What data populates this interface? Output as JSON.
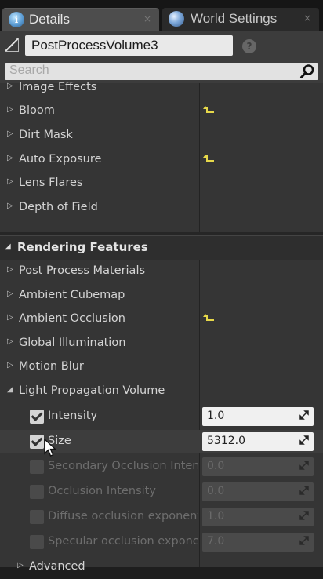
{
  "tabs": [
    {
      "label": "Details",
      "icon": "info-icon",
      "close": "×"
    },
    {
      "label": "World Settings",
      "icon": "globe-icon",
      "close": "×"
    }
  ],
  "object": {
    "name": "PostProcessVolume3",
    "help": "?"
  },
  "search": {
    "placeholder": "Search"
  },
  "sections_top": [
    {
      "label": "Image Effects",
      "arrow": "▷",
      "reset": false
    },
    {
      "label": "Bloom",
      "arrow": "▷",
      "reset": true
    },
    {
      "label": "Dirt Mask",
      "arrow": "▷",
      "reset": false
    },
    {
      "label": "Auto Exposure",
      "arrow": "▷",
      "reset": true
    },
    {
      "label": "Lens Flares",
      "arrow": "▷",
      "reset": false
    },
    {
      "label": "Depth of Field",
      "arrow": "▷",
      "reset": false
    }
  ],
  "category": {
    "label": "Rendering Features",
    "arrow": "◢"
  },
  "sections_render": [
    {
      "label": "Post Process Materials",
      "arrow": "▷",
      "reset": false
    },
    {
      "label": "Ambient Cubemap",
      "arrow": "▷",
      "reset": false
    },
    {
      "label": "Ambient Occlusion",
      "arrow": "▷",
      "reset": true
    },
    {
      "label": "Global Illumination",
      "arrow": "▷",
      "reset": false
    },
    {
      "label": "Motion Blur",
      "arrow": "▷",
      "reset": false
    },
    {
      "label": "Light Propagation Volume",
      "arrow": "◢",
      "reset": false
    }
  ],
  "lpv_props": [
    {
      "label": "Intensity",
      "value": "1.0",
      "checked": true,
      "enabled": true
    },
    {
      "label": "Size",
      "value": "5312.0",
      "checked": true,
      "enabled": true
    },
    {
      "label": "Secondary Occlusion Intensity",
      "value": "0.0",
      "checked": false,
      "enabled": false
    },
    {
      "label": "Occlusion Intensity",
      "value": "0.0",
      "checked": false,
      "enabled": false
    },
    {
      "label": "Diffuse occlusion exponent",
      "value": "1.0",
      "checked": false,
      "enabled": false
    },
    {
      "label": "Specular occlusion exponent",
      "value": "7.0",
      "checked": false,
      "enabled": false
    }
  ],
  "advanced": {
    "label": "Advanced",
    "arrow": "▷"
  },
  "colors": {
    "reset_arrow": "#e6d84a",
    "panel_bg": "#353535",
    "tab_active": "#4d4d4d"
  }
}
